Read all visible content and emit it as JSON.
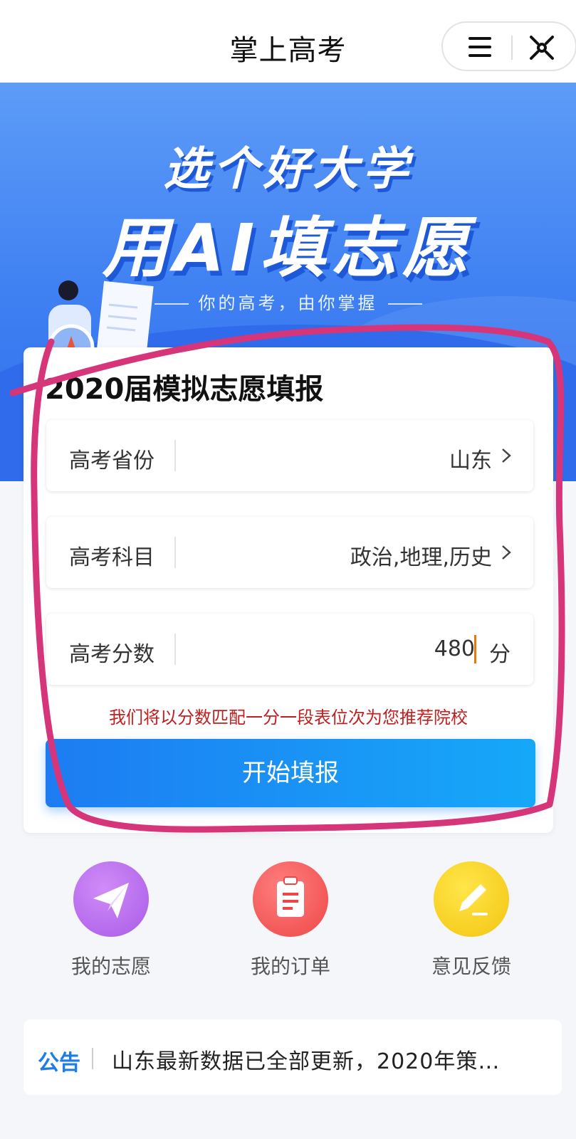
{
  "header": {
    "title": "掌上高考",
    "menu_icon": "menu-icon",
    "close_icon": "close-icon"
  },
  "hero": {
    "line1": "选个好大学",
    "line2": "用AI填志愿",
    "tagline": "你的高考，由你掌握"
  },
  "form": {
    "title": "2020届模拟志愿填报",
    "fields": [
      {
        "label": "高考省份",
        "value": "山东"
      },
      {
        "label": "高考科目",
        "value": "政治,地理,历史"
      },
      {
        "label": "高考分数",
        "value": "480",
        "unit": "分"
      }
    ],
    "hint": "我们将以分数匹配一分一段表位次为您推荐院校",
    "submit_label": "开始填报"
  },
  "quick_links": [
    {
      "label": "我的志愿",
      "icon": "paper-plane-icon",
      "color": "#b86ef0"
    },
    {
      "label": "我的订单",
      "icon": "clipboard-icon",
      "color": "#f25a5a"
    },
    {
      "label": "意见反馈",
      "icon": "pencil-icon",
      "color": "#f7cf1f"
    }
  ],
  "notice": {
    "tag": "公告",
    "text": "山东最新数据已全部更新，2020年策…"
  },
  "colors": {
    "accent": "#1f7be8",
    "hint_red": "#c0201f",
    "annotation": "#d6357a"
  }
}
